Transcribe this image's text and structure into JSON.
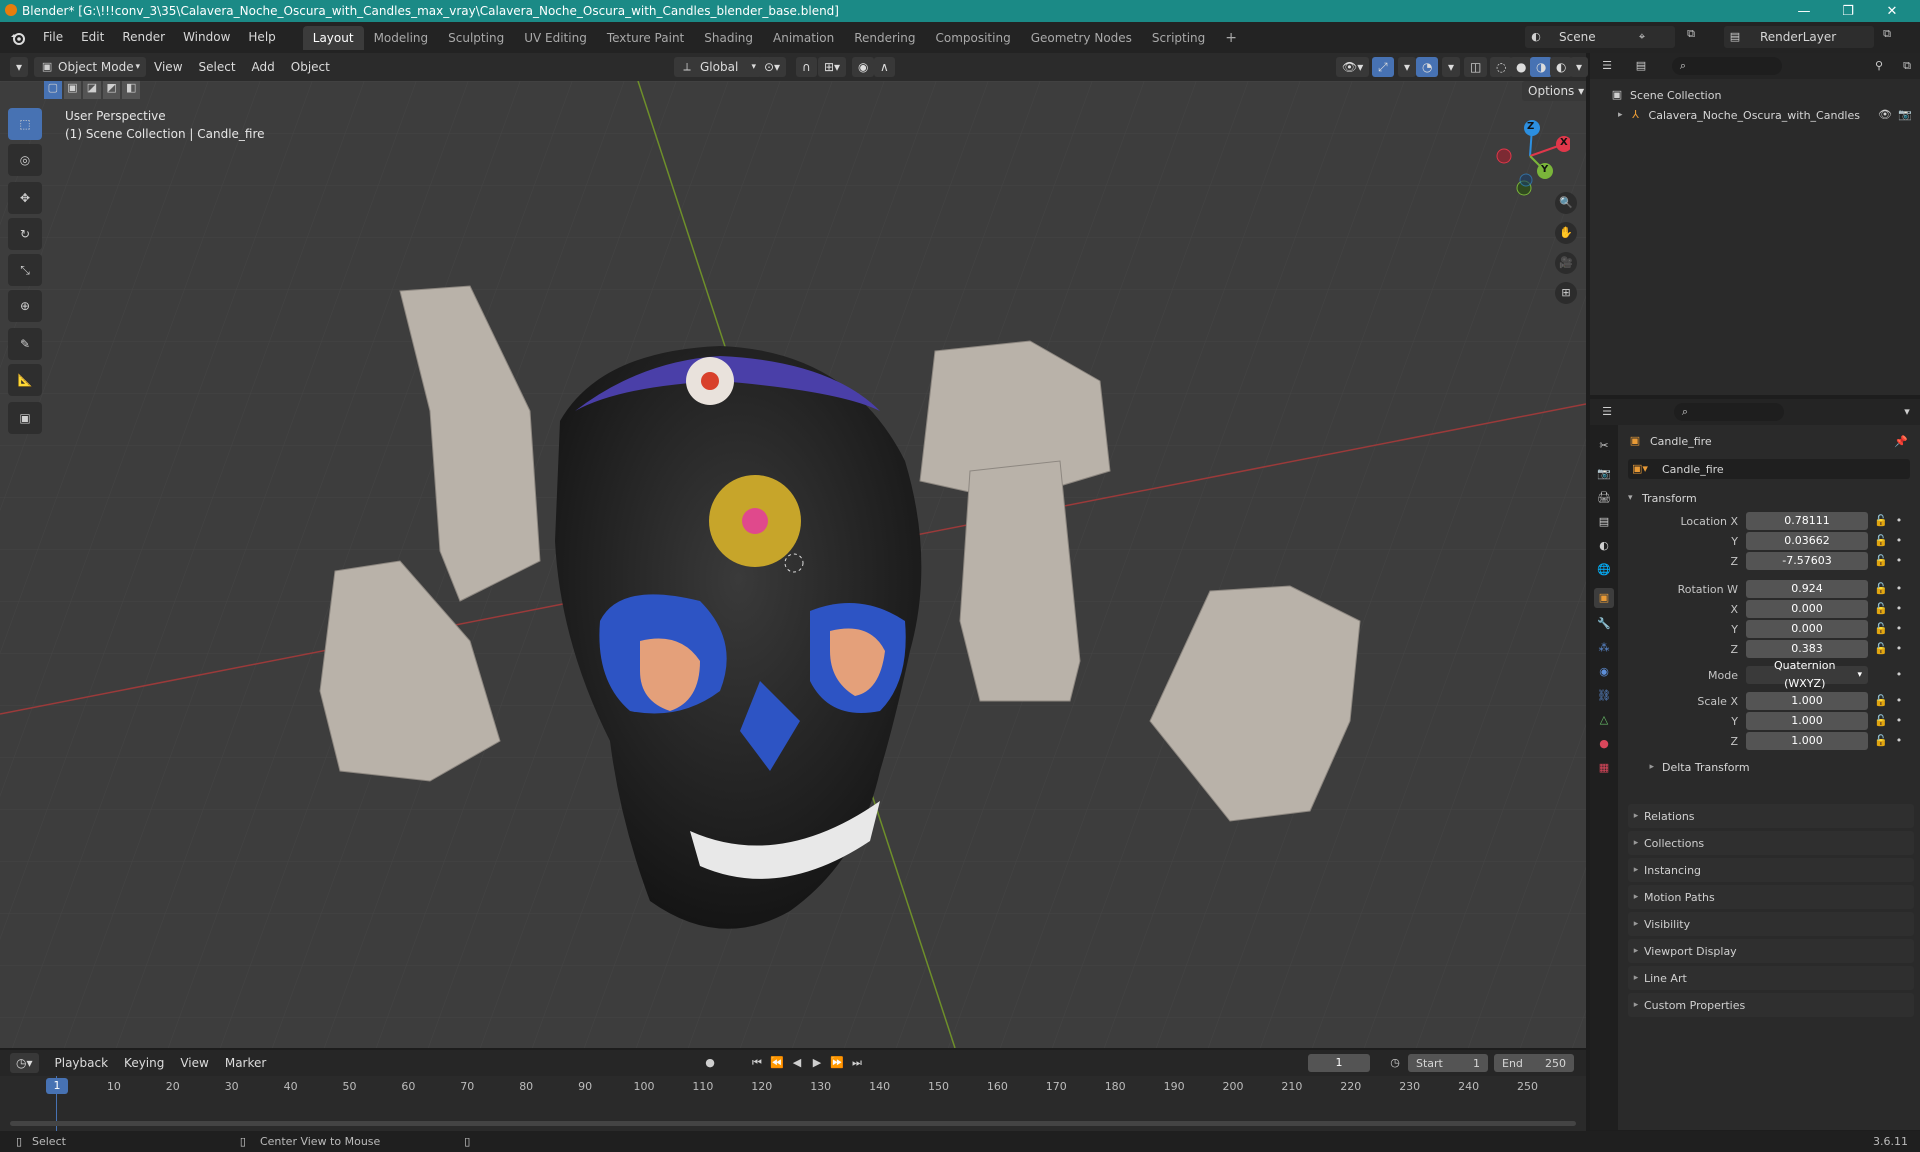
{
  "titlebar": {
    "title": "Blender* [G:\\!!!conv_3\\35\\Calavera_Noche_Oscura_with_Candles_max_vray\\Calavera_Noche_Oscura_with_Candles_blender_base.blend]",
    "minimize": "—",
    "maximize": "❐",
    "close": "✕"
  },
  "menus": [
    "File",
    "Edit",
    "Render",
    "Window",
    "Help"
  ],
  "workspaces": [
    "Layout",
    "Modeling",
    "Sculpting",
    "UV Editing",
    "Texture Paint",
    "Shading",
    "Animation",
    "Rendering",
    "Compositing",
    "Geometry Nodes",
    "Scripting"
  ],
  "scene": {
    "scene_name": "Scene",
    "view_layer": "RenderLayer"
  },
  "viewport": {
    "mode": "Object Mode",
    "menus": [
      "View",
      "Select",
      "Add",
      "Object"
    ],
    "orientation": "Global",
    "options_label": "Options",
    "perspective_label": "User Perspective",
    "collection_label": "(1) Scene Collection | Candle_fire",
    "gizmo": {
      "z": "Z",
      "x": "X",
      "y": "Y"
    }
  },
  "outliner": {
    "root": "Scene Collection",
    "items": [
      "Calavera_Noche_Oscura_with_Candles"
    ]
  },
  "properties": {
    "object_name": "Candle_fire",
    "data_name": "Candle_fire",
    "transform_title": "Transform",
    "location": {
      "label": "Location X",
      "x": "0.78111",
      "y": "0.03662",
      "z": "-7.57603"
    },
    "rotation": {
      "label": "Rotation W",
      "w": "0.924",
      "x": "0.000",
      "y": "0.000",
      "z": "0.383"
    },
    "mode_label": "Mode",
    "mode_value": "Quaternion (WXYZ)",
    "scale": {
      "label": "Scale X",
      "x": "1.000",
      "y": "1.000",
      "z": "1.000"
    },
    "axis_y": "Y",
    "axis_z": "Z",
    "axis_x": "X",
    "delta": "Delta Transform",
    "sections": [
      "Relations",
      "Collections",
      "Instancing",
      "Motion Paths",
      "Visibility",
      "Viewport Display",
      "Line Art",
      "Custom Properties"
    ]
  },
  "timeline": {
    "menus": [
      "Playback",
      "Keying",
      "View",
      "Marker"
    ],
    "current_frame": "1",
    "start_label": "Start",
    "start": "1",
    "end_label": "End",
    "end": "250",
    "ticks": [
      "1",
      "10",
      "20",
      "30",
      "40",
      "50",
      "60",
      "70",
      "80",
      "90",
      "100",
      "110",
      "120",
      "130",
      "140",
      "150",
      "160",
      "170",
      "180",
      "190",
      "200",
      "210",
      "220",
      "230",
      "240",
      "250"
    ]
  },
  "statusbar": {
    "select": "Select",
    "center": "Center View to Mouse",
    "version": "3.6.11"
  }
}
